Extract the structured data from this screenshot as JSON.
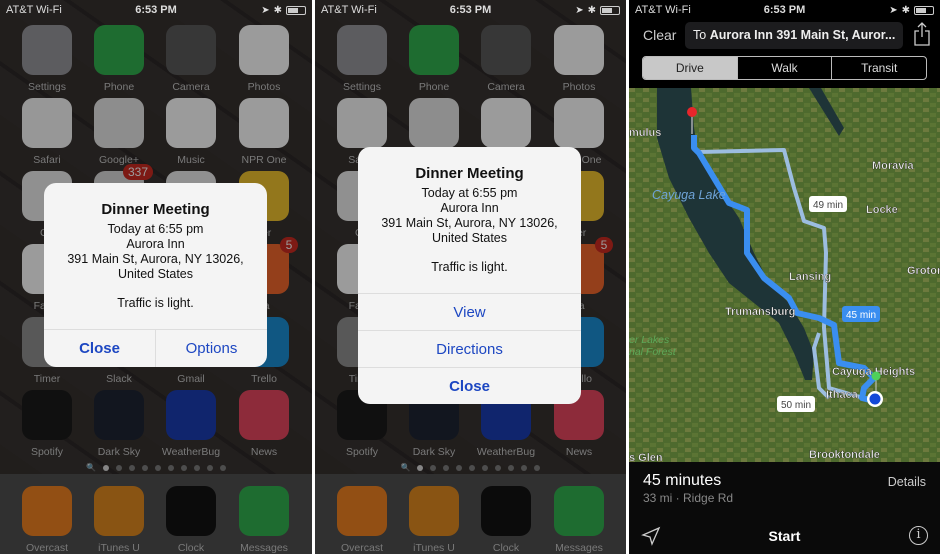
{
  "status": {
    "carrier": "AT&T Wi-Fi",
    "time": "6:53 PM"
  },
  "home": {
    "apps": [
      {
        "label": "Settings",
        "color": "#8e8e93"
      },
      {
        "label": "Phone",
        "color": "#2fa74a"
      },
      {
        "label": "Camera",
        "color": "#555"
      },
      {
        "label": "Photos",
        "color": "#eee"
      },
      {
        "label": "Safari",
        "color": "#e8e8e8"
      },
      {
        "label": "Google+",
        "color": "#d9d9d9"
      },
      {
        "label": "Music",
        "color": "#eee"
      },
      {
        "label": "NPR One",
        "color": "#eee"
      },
      {
        "label": "Go",
        "color": "#ddd"
      },
      {
        "label": "",
        "color": "#ccc",
        "badge": "337"
      },
      {
        "label": "",
        "color": "#ddd"
      },
      {
        "label": "ver",
        "color": "#e2b72b"
      },
      {
        "label": "Fanta",
        "color": "#eee"
      },
      {
        "label": "",
        "color": "#888"
      },
      {
        "label": "",
        "color": "#888"
      },
      {
        "label": "va",
        "color": "#e4622a",
        "badge": "5"
      },
      {
        "label": "Timer",
        "color": "#888"
      },
      {
        "label": "Slack",
        "color": "#888"
      },
      {
        "label": "Gmail",
        "color": "#888"
      },
      {
        "label": "Trello",
        "color": "#1a86c8"
      },
      {
        "label": "Spotify",
        "color": "#1a1a1a"
      },
      {
        "label": "Dark Sky",
        "color": "#1d2331"
      },
      {
        "label": "WeatherBug",
        "color": "#1a3aa8"
      },
      {
        "label": "News",
        "color": "#d9425a"
      }
    ],
    "dock": [
      {
        "label": "Overcast",
        "color": "#e07a1f"
      },
      {
        "label": "iTunes U",
        "color": "#d3811e"
      },
      {
        "label": "Clock",
        "color": "#111"
      },
      {
        "label": "Messages",
        "color": "#2fa74a"
      }
    ],
    "page_count": 11,
    "current_page": 1
  },
  "alert": {
    "title": "Dinner Meeting",
    "time": "Today at 6:55 pm",
    "place": "Aurora Inn",
    "address": "391 Main St, Aurora, NY  13026,",
    "country": "United States",
    "traffic": "Traffic is light.",
    "close": "Close",
    "options": "Options",
    "view": "View",
    "directions": "Directions"
  },
  "maps": {
    "clear": "Clear",
    "dest_prefix": "To",
    "dest": "Aurora Inn 391 Main St, Auror...",
    "modes": [
      "Drive",
      "Walk",
      "Transit"
    ],
    "selected_mode": "Drive",
    "labels": {
      "mulus": "mulus",
      "lake": "Cayuga Lake",
      "moravia": "Moravia",
      "locke": "Locke",
      "lansing": "Lansing",
      "groton": "Groton",
      "trumansburg": "Trumansburg",
      "forest1": "er Lakes",
      "forest2": "nal Forest",
      "heights": "Cayuga Heights",
      "ithaca": "Ithaca",
      "brooktondale": "Brooktondale",
      "glen": "s Glen"
    },
    "routes": [
      {
        "time": "45 min",
        "selected": true
      },
      {
        "time": "49 min"
      },
      {
        "time": "50 min"
      }
    ],
    "route_color": "#3a8ef0",
    "summary": {
      "duration": "45 minutes",
      "detail": "33 mi · Ridge Rd",
      "details": "Details",
      "start": "Start"
    }
  }
}
